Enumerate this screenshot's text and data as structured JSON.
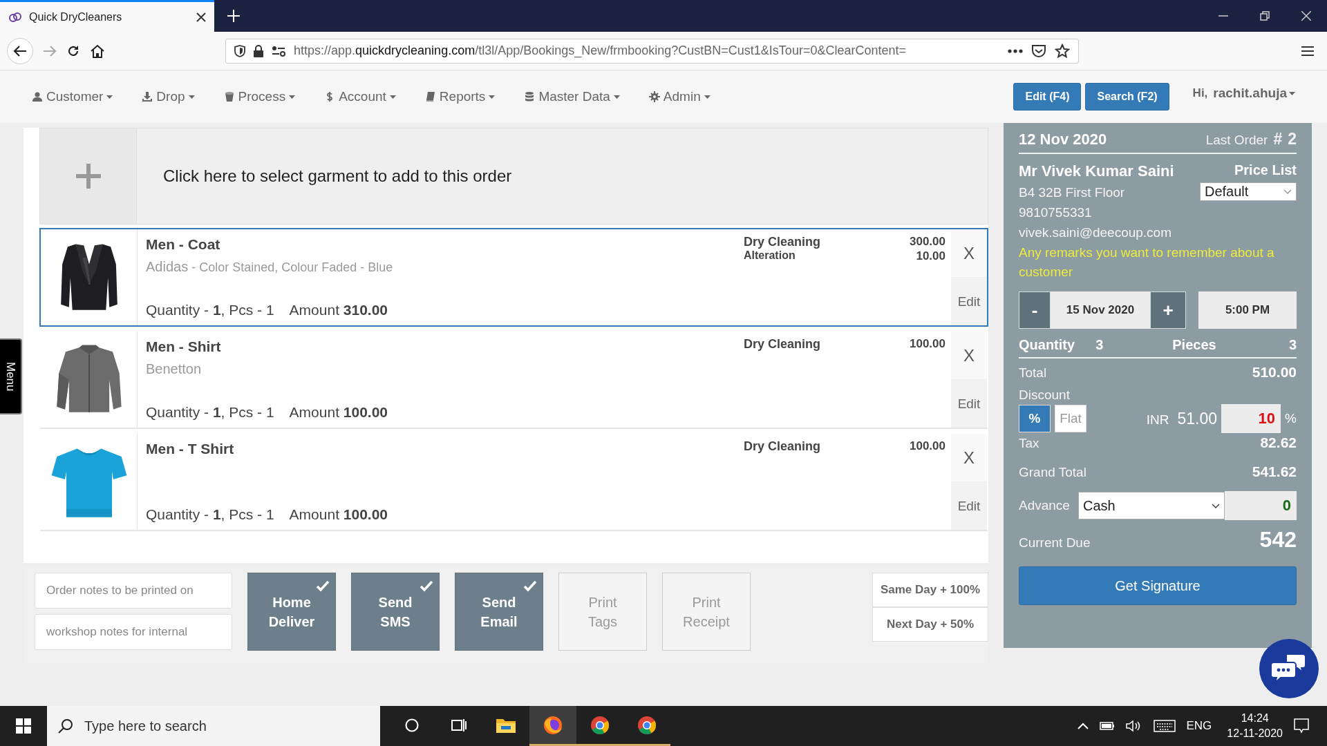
{
  "browser": {
    "tab": {
      "title": "Quick DryCleaners",
      "selected": true
    },
    "url": "https://app.**quickdrycleaning.com**/tl3l/App/Bookings_New/frmbooking?CustBN=Cust1&IsTour=0&ClearContent="
  },
  "nav": {
    "items": [
      {
        "kind": "user",
        "label": "Customer"
      },
      {
        "kind": "download",
        "label": "Drop"
      },
      {
        "kind": "bucket",
        "label": "Process"
      },
      {
        "kind": "dollar",
        "label": "Account"
      },
      {
        "kind": "book",
        "label": "Reports"
      },
      {
        "kind": "database",
        "label": "Master Data"
      },
      {
        "kind": "gear",
        "label": "Admin"
      }
    ],
    "buttons": [
      "Edit (F4)",
      "Search (F2)"
    ],
    "greeting": "Hi,",
    "user": "rachit.ahuja"
  },
  "side_tab": "Menu",
  "add_row": {
    "text": "Click here to select garment to add to this order"
  },
  "items": [
    {
      "kind": "coat",
      "name": "Men - Coat",
      "brand": "Adidas",
      "details": " - Color Stained, Colour Faded - Blue",
      "line": "Quantity - **1**, Pcs - 1",
      "amount_label": "Amount",
      "amount": "310.00",
      "services": [
        {
          "name": "Dry Cleaning",
          "price": "300.00"
        },
        {
          "name": "Alteration",
          "price": "10.00"
        }
      ],
      "remove": "X",
      "edit": "Edit",
      "selected": true
    },
    {
      "kind": "shirt",
      "name": "Men - Shirt",
      "brand": "Benetton",
      "line": "Quantity - **1**, Pcs - 1",
      "amount_label": "Amount",
      "amount": "100.00",
      "services": [
        {
          "name": "Dry Cleaning",
          "price": "100.00"
        }
      ],
      "remove": "X",
      "edit": "Edit",
      "selected": false
    },
    {
      "kind": "tshirt",
      "name": "Men - T Shirt",
      "line": "Quantity - **1**, Pcs - 1",
      "amount_label": "Amount",
      "amount": "100.00",
      "services": [
        {
          "name": "Dry Cleaning",
          "price": "100.00"
        }
      ],
      "remove": "X",
      "edit": "Edit",
      "selected": false
    }
  ],
  "bottom": {
    "notes": [
      {
        "placeholder": "Order notes to be printed on"
      },
      {
        "placeholder": "workshop notes for internal"
      }
    ],
    "options": [
      {
        "kind": "toggle",
        "label": "Home\nDeliver",
        "checked": true
      },
      {
        "kind": "toggle",
        "label": "Send\nSMS",
        "checked": true
      },
      {
        "kind": "toggle",
        "label": "Send\nEmail",
        "checked": true
      },
      {
        "kind": "print",
        "label": "Print\nTags"
      },
      {
        "kind": "print",
        "label": "Print\nReceipt"
      }
    ],
    "express": [
      "Same Day + 100%",
      "Next Day + 50%"
    ]
  },
  "panel": {
    "date": "12 Nov 2020",
    "last_order_label": "Last Order",
    "last_order_hash": "#",
    "last_order_number": "2",
    "customer": {
      "name": "Mr Vivek Kumar Saini",
      "address": "B4 32B First Floor",
      "phone": "9810755331",
      "email": "vivek.saini@deecoup.com",
      "remarks": "Any remarks you want to remember about a customer"
    },
    "price_list": {
      "label": "Price List",
      "value": "Default"
    },
    "delivery": {
      "minus": "-",
      "date": "15 Nov 2020",
      "plus": "+",
      "time": "5:00 PM"
    },
    "quantity_label": "Quantity",
    "quantity": "3",
    "pieces_label": "Pieces",
    "pieces": "3",
    "total_label": "Total",
    "total": "510.00",
    "discount": {
      "label": "Discount",
      "modes": [
        {
          "label": "%",
          "selected": true
        },
        {
          "label": "Flat",
          "selected": false
        }
      ],
      "currency": "INR",
      "amount": "51.00",
      "value": "10",
      "unit": "%"
    },
    "tax_label": "Tax",
    "tax": "82.62",
    "grand_total_label": "Grand Total",
    "grand_total": "541.62",
    "advance": {
      "label": "Advance",
      "method": "Cash",
      "value": "0"
    },
    "current_due_label": "Current Due",
    "current_due": "542",
    "signature_button": "Get Signature"
  },
  "taskbar": {
    "search_placeholder": "Type here to search",
    "apps": [
      {
        "kind": "cortana",
        "selected": false
      },
      {
        "kind": "taskview",
        "selected": false
      },
      {
        "kind": "explorer",
        "selected": false
      },
      {
        "kind": "firefox",
        "selected": true
      },
      {
        "kind": "chrome",
        "selected": false
      },
      {
        "kind": "chrome",
        "selected": false
      }
    ],
    "language": "ENG",
    "time": "14:24",
    "date": "12-11-2020"
  }
}
